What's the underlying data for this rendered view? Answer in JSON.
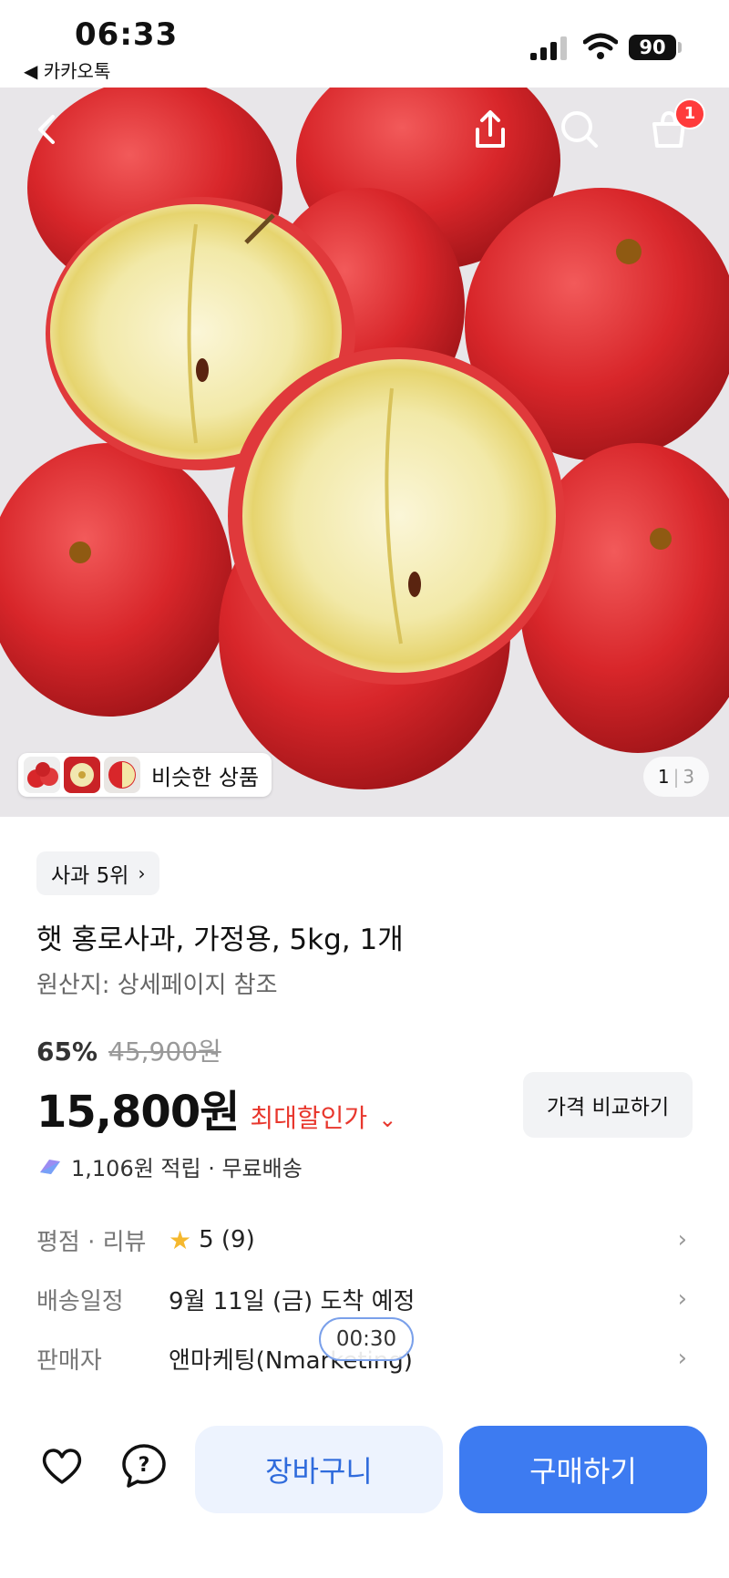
{
  "status_bar": {
    "time": "06:33",
    "back_app": "◀ 카카오톡",
    "battery": "90"
  },
  "header": {
    "cart_count": "1"
  },
  "gallery": {
    "similar_label": "비슷한 상품",
    "page_current": "1",
    "page_separator": "|",
    "page_total": "3"
  },
  "product": {
    "rank_chip": "사과 5위",
    "title": "햇 홍로사과, 가정용, 5kg, 1개",
    "origin": "원산지: 상세페이지 참조",
    "discount_percent": "65%",
    "original_price": "45,900원",
    "price": "15,800원",
    "max_discount_label": "최대할인가",
    "compare_button": "가격 비교하기",
    "reward_text": "1,106원 적립 · 무료배송"
  },
  "info": {
    "rating_label": "평점 · 리뷰",
    "rating_value": "5 (9)",
    "delivery_label": "배송일정",
    "delivery_value": "9월 11일 (금) 도착 예정",
    "seller_label": "판매자",
    "seller_value": "앤마케팅(Nmarketing)"
  },
  "timer": "00:30",
  "bottom": {
    "cart_button": "장바구니",
    "buy_button": "구매하기"
  },
  "colors": {
    "accent": "#3d7bf1",
    "discount_red": "#e8372d",
    "badge_red": "#ff3b3b"
  }
}
